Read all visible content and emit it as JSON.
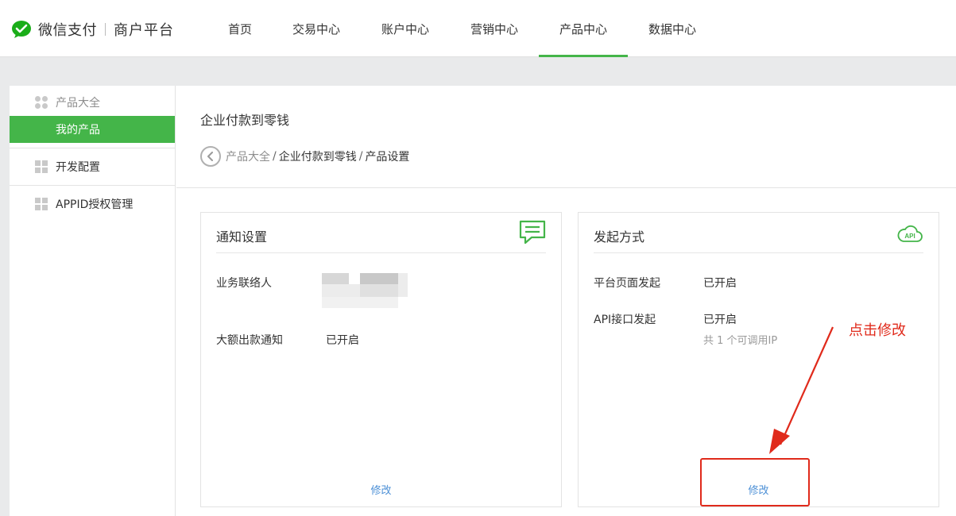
{
  "header": {
    "logo_text": "微信支付",
    "logo_sub": "商户平台",
    "nav": [
      "首页",
      "交易中心",
      "账户中心",
      "营销中心",
      "产品中心",
      "数据中心"
    ],
    "active_nav": 4
  },
  "sidebar": {
    "groups": [
      {
        "label": "产品大全",
        "sub": "我的产品"
      },
      {
        "label": "开发配置"
      },
      {
        "label": "APPID授权管理"
      }
    ]
  },
  "content": {
    "title": "企业付款到零钱",
    "breadcrumb": [
      "产品大全",
      "企业付款到零钱",
      "产品设置"
    ],
    "breadcrumb_sep": "/"
  },
  "cards": {
    "notify": {
      "title": "通知设置",
      "rows": [
        {
          "label": "业务联络人",
          "value": ""
        },
        {
          "label": "大额出款通知",
          "value": "已开启"
        }
      ],
      "link": "修改"
    },
    "initiate": {
      "title": "发起方式",
      "icon_text": "API",
      "rows": [
        {
          "label": "平台页面发起",
          "value": "已开启"
        },
        {
          "label": "API接口发起",
          "value": "已开启",
          "note": "共 1 个可调用IP"
        }
      ],
      "link": "修改"
    }
  },
  "annotation": {
    "text": "点击修改",
    "color": "#e02a1b"
  },
  "colors": {
    "accent": "#44b549",
    "link": "#4b8fd6"
  }
}
